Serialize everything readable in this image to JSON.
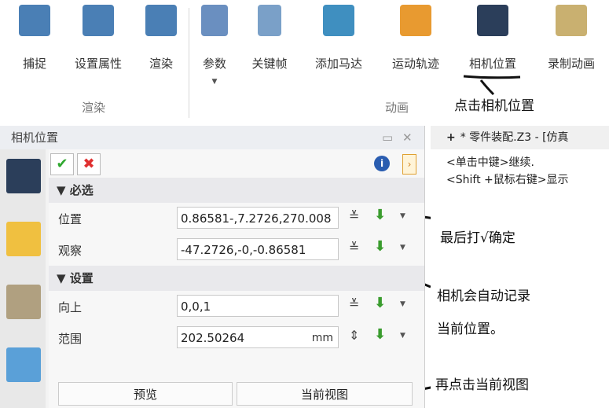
{
  "ribbon": {
    "buttons": [
      {
        "label": "捕捉",
        "icon": "camera-capture-icon"
      },
      {
        "label": "设置属性",
        "icon": "camera-properties-icon"
      },
      {
        "label": "渲染",
        "icon": "camera-render-icon"
      },
      {
        "label": "参数",
        "icon": "parameters-icon"
      },
      {
        "label": "关键帧",
        "icon": "key-icon"
      },
      {
        "label": "添加马达",
        "icon": "motor-icon"
      },
      {
        "label": "运动轨迹",
        "icon": "motion-path-icon"
      },
      {
        "label": "相机位置",
        "icon": "movie-camera-icon"
      },
      {
        "label": "录制动画",
        "icon": "record-animation-icon"
      }
    ],
    "groups": [
      "渲染",
      "动画"
    ]
  },
  "annotations": {
    "click_camera_position": "点击相机位置",
    "finally_confirm": "最后打√确定",
    "auto_record_line1": "相机会自动记录",
    "auto_record_line2": "当前位置。",
    "click_current_view": "再点击当前视图"
  },
  "panel": {
    "title": "相机位置",
    "required_section": "必选",
    "settings_section": "设置",
    "fields": {
      "position": {
        "label": "位置",
        "value": "7.2726,270.008,-0.86581"
      },
      "look_at": {
        "label": "观察",
        "value": "-47.2726,-0,-0.86581"
      },
      "up": {
        "label": "向上",
        "value": "0,0,1"
      },
      "range": {
        "label": "范围",
        "value": "202.50264",
        "unit": "mm"
      }
    },
    "preview_label": "预览",
    "current_view_label": "当前视图"
  },
  "document": {
    "tab_title": "* 零件装配.Z3 - [仿真",
    "hint1": "<单击中键>继续.",
    "hint2": "<Shift +鼠标右键>显示"
  },
  "colors": {
    "confirm": "#2fa82f",
    "cancel": "#e03030",
    "pick": "#3a9c2e"
  }
}
